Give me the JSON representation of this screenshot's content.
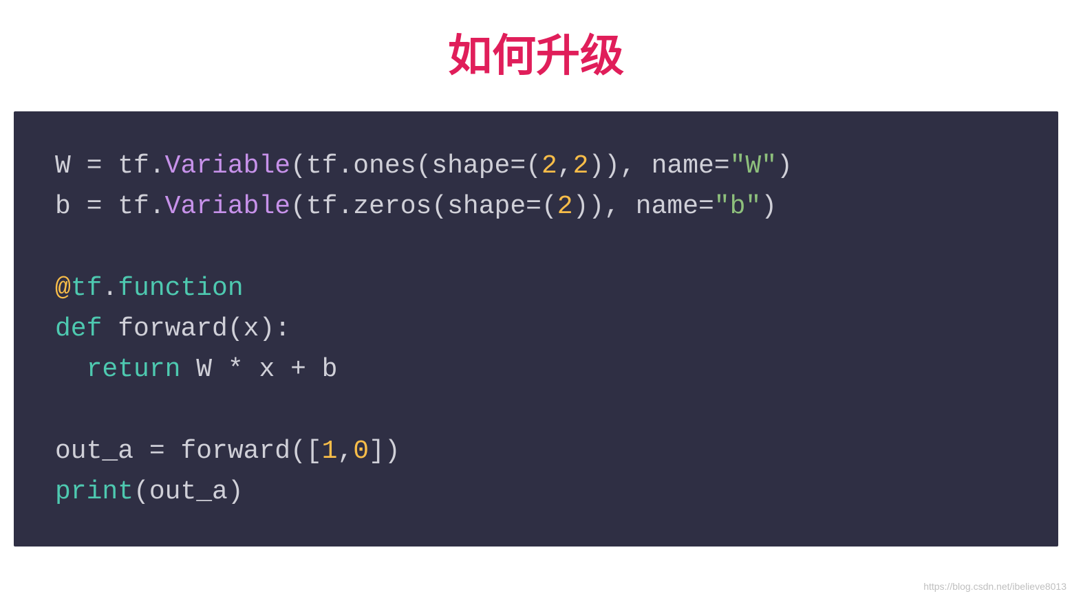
{
  "title": "如何升级",
  "code": {
    "lines": [
      {
        "tokens": [
          {
            "t": "W = tf.",
            "c": "tok-default"
          },
          {
            "t": "Variable",
            "c": "tok-class"
          },
          {
            "t": "(tf.ones(shape=(",
            "c": "tok-default"
          },
          {
            "t": "2",
            "c": "tok-number"
          },
          {
            "t": ",",
            "c": "tok-default"
          },
          {
            "t": "2",
            "c": "tok-number"
          },
          {
            "t": ")), name=",
            "c": "tok-default"
          },
          {
            "t": "\"W\"",
            "c": "tok-string"
          },
          {
            "t": ")",
            "c": "tok-default"
          }
        ]
      },
      {
        "tokens": [
          {
            "t": "b = tf.",
            "c": "tok-default"
          },
          {
            "t": "Variable",
            "c": "tok-class"
          },
          {
            "t": "(tf.zeros(shape=(",
            "c": "tok-default"
          },
          {
            "t": "2",
            "c": "tok-number"
          },
          {
            "t": ")), name=",
            "c": "tok-default"
          },
          {
            "t": "\"b\"",
            "c": "tok-string"
          },
          {
            "t": ")",
            "c": "tok-default"
          }
        ]
      },
      {
        "tokens": [
          {
            "t": " ",
            "c": "tok-default"
          }
        ]
      },
      {
        "tokens": [
          {
            "t": "@",
            "c": "tok-decorator-at"
          },
          {
            "t": "tf",
            "c": "tok-decorator-name"
          },
          {
            "t": ".",
            "c": "tok-default"
          },
          {
            "t": "function",
            "c": "tok-decorator-name"
          }
        ]
      },
      {
        "tokens": [
          {
            "t": "def",
            "c": "tok-keyword"
          },
          {
            "t": " forward(x):",
            "c": "tok-default"
          }
        ]
      },
      {
        "tokens": [
          {
            "t": "  ",
            "c": "tok-default"
          },
          {
            "t": "return",
            "c": "tok-keyword"
          },
          {
            "t": " W * x + b",
            "c": "tok-default"
          }
        ]
      },
      {
        "tokens": [
          {
            "t": " ",
            "c": "tok-default"
          }
        ]
      },
      {
        "tokens": [
          {
            "t": "out_a = forward([",
            "c": "tok-default"
          },
          {
            "t": "1",
            "c": "tok-number"
          },
          {
            "t": ",",
            "c": "tok-default"
          },
          {
            "t": "0",
            "c": "tok-number"
          },
          {
            "t": "])",
            "c": "tok-default"
          }
        ]
      },
      {
        "tokens": [
          {
            "t": "print",
            "c": "tok-builtin"
          },
          {
            "t": "(out_a)",
            "c": "tok-default"
          }
        ]
      }
    ]
  },
  "watermark": "https://blog.csdn.net/ibelieve8013"
}
